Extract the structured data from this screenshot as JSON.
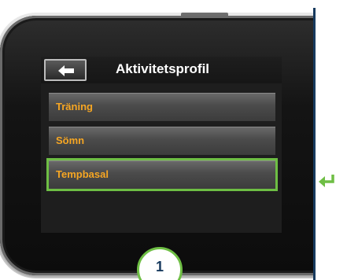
{
  "screen": {
    "title": "Aktivitetsprofil",
    "back_icon": "back-arrow-icon"
  },
  "menu": {
    "items": [
      {
        "label": "Träning",
        "selected": false
      },
      {
        "label": "Sömn",
        "selected": false
      },
      {
        "label": "Tempbasal",
        "selected": true
      }
    ]
  },
  "callout": {
    "number": "1"
  },
  "side": {
    "return_icon": "return-arrow-icon"
  },
  "colors": {
    "menu_text": "#f6a623",
    "highlight": "#6ebe44",
    "navy": "#173a5e"
  }
}
